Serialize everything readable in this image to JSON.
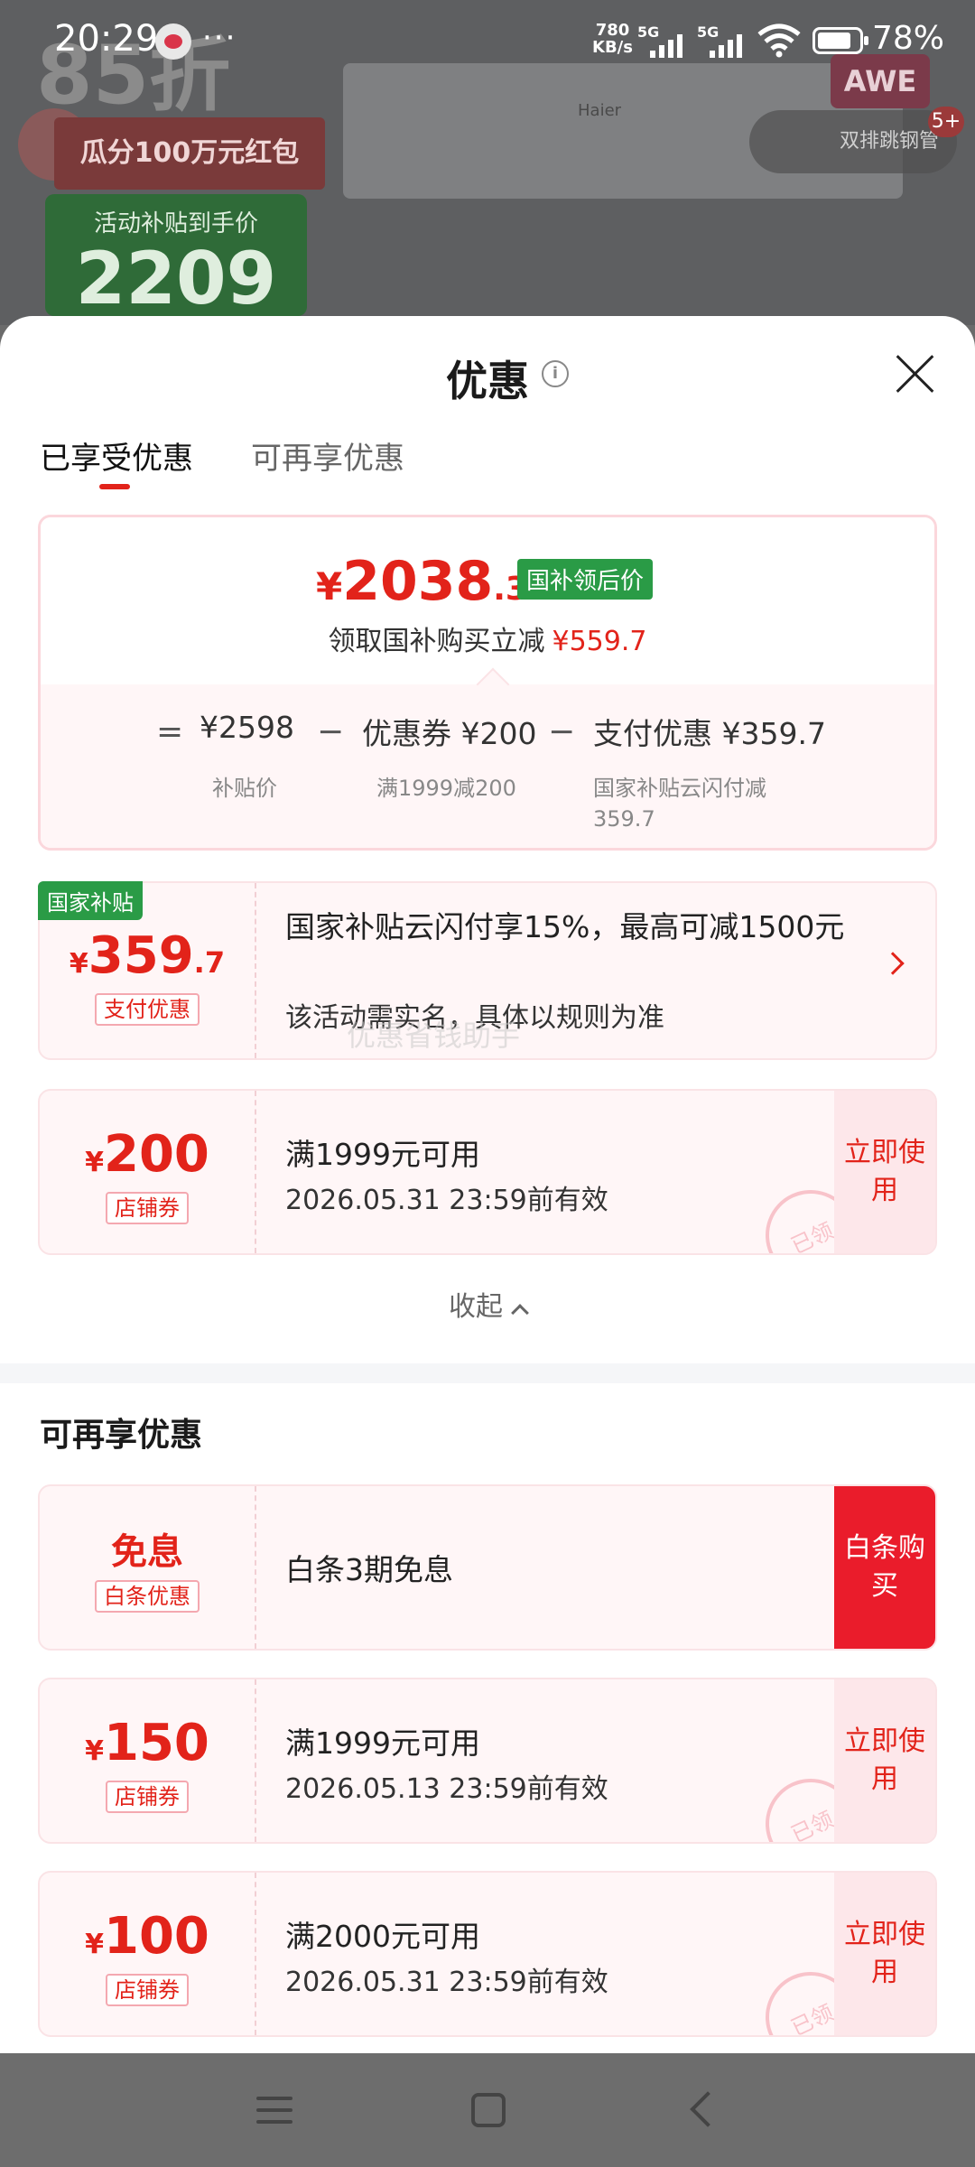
{
  "status_bar": {
    "time": "20:29",
    "speed_value": "780",
    "speed_unit": "KB/s",
    "sim1": "5G",
    "sim2": "5G",
    "battery": "78%"
  },
  "backdrop": {
    "promo_big": "85折",
    "promo_banner": "瓜分100万元红包",
    "subsidy_label": "活动补贴到手价",
    "subsidy_price": "2209",
    "brand": "Haier",
    "event": "AWE",
    "compare": "双排跳钢管",
    "badge": "5+"
  },
  "sheet": {
    "title": "优惠",
    "tabs": [
      "已享受优惠",
      "可再享优惠"
    ]
  },
  "summary": {
    "currency": "¥",
    "final_int": "2038",
    "final_dec": ".3",
    "tag": "国补领后价",
    "save_label": "领取国补购买立减",
    "save_amount": "¥559.7",
    "eq": "=",
    "minus": "−",
    "base_price": "¥2598",
    "base_label": "补贴价",
    "coupon_value": "优惠券 ¥200",
    "coupon_label": "满1999减200",
    "pay_value": "支付优惠 ¥359.7",
    "pay_label": "国家补贴云闪付减359.7"
  },
  "enjoyed": [
    {
      "corner_tag": "国家补贴",
      "currency": "¥",
      "amount": "359",
      "decimal": ".7",
      "kind": "支付优惠",
      "title": "国家补贴云闪付享15%，最高可减1500元",
      "desc": "该活动需实名，具体以规则为准"
    },
    {
      "currency": "¥",
      "amount": "200",
      "kind": "店铺券",
      "title": "满1999元可用",
      "desc": "2026.05.31 23:59前有效",
      "action": "立即使用",
      "stamp": "已领"
    }
  ],
  "watermark": "优惠省钱助手",
  "collapse_label": "收起",
  "more_section": {
    "title": "可再享优惠",
    "items": [
      {
        "amount": "免息",
        "kind": "白条优惠",
        "title": "白条3期免息",
        "action": "白条购买"
      },
      {
        "currency": "¥",
        "amount": "150",
        "kind": "店铺券",
        "title": "满1999元可用",
        "desc": "2026.05.13 23:59前有效",
        "action": "立即使用",
        "stamp": "已领"
      },
      {
        "currency": "¥",
        "amount": "100",
        "kind": "店铺券",
        "title": "满2000元可用",
        "desc": "2026.05.31 23:59前有效",
        "action": "立即使用",
        "stamp": "已领"
      }
    ]
  },
  "colors": {
    "accent_red": "#e2231a",
    "gov_green": "#2a9b46",
    "card_bg": "#fff6f7"
  }
}
